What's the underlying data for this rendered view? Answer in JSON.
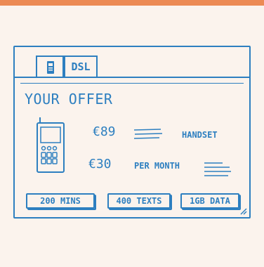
{
  "tabs": [
    {
      "label": "",
      "icon": "phone-icon"
    },
    {
      "label": "DSL"
    }
  ],
  "offer": {
    "title": "YOUR OFFER",
    "handset_price": "€89",
    "handset_label": "HANDSET",
    "monthly_price": "€30",
    "monthly_label": "PER MONTH"
  },
  "chips": [
    {
      "label": "200 MINS"
    },
    {
      "label": "400 TEXTS"
    },
    {
      "label": "1GB DATA"
    }
  ],
  "colors": {
    "accent": "#ec8a54",
    "sketch": "#2d7fc0",
    "background": "#fbf3ed"
  }
}
